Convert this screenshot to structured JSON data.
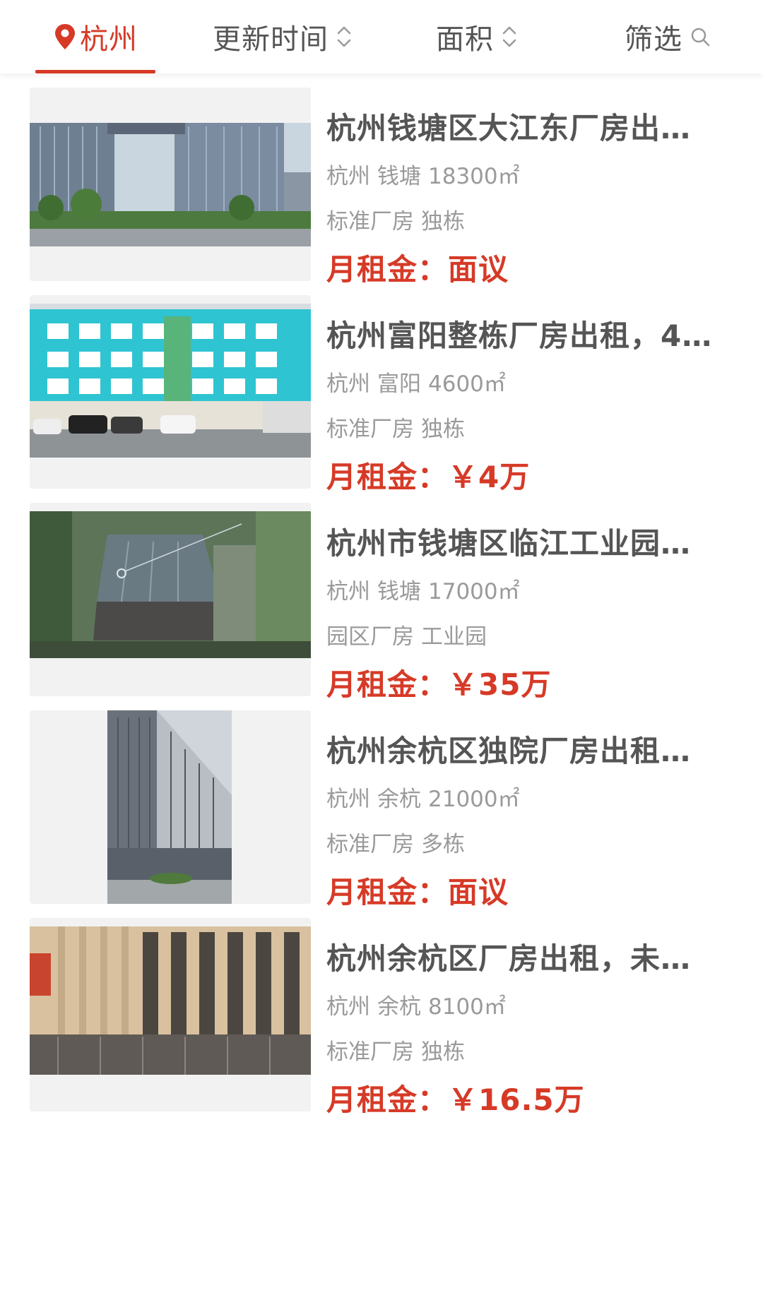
{
  "filter_bar": {
    "city": "杭州",
    "update_time": "更新时间",
    "area": "面积",
    "screen": "筛选"
  },
  "accent_color": "#d63a27",
  "listings": [
    {
      "title": "杭州钱塘区大江东厂房出…",
      "city": "杭州",
      "district": "钱塘",
      "area": "18300㎡",
      "tag1": "标准厂房",
      "tag2": "独栋",
      "rent_label": "月租金：",
      "rent_value": "面议"
    },
    {
      "title": "杭州富阳整栋厂房出租，4…",
      "city": "杭州",
      "district": "富阳",
      "area": "4600㎡",
      "tag1": "标准厂房",
      "tag2": "独栋",
      "rent_label": "月租金：",
      "rent_value": "￥4万"
    },
    {
      "title": "杭州市钱塘区临江工业园…",
      "city": "杭州",
      "district": "钱塘",
      "area": "17000㎡",
      "tag1": "园区厂房",
      "tag2": "工业园",
      "rent_label": "月租金：",
      "rent_value": "￥35万"
    },
    {
      "title": "杭州余杭区独院厂房出租…",
      "city": "杭州",
      "district": "余杭",
      "area": "21000㎡",
      "tag1": "标准厂房",
      "tag2": "多栋",
      "rent_label": "月租金：",
      "rent_value": "面议"
    },
    {
      "title": "杭州余杭区厂房出租，未…",
      "city": "杭州",
      "district": "余杭",
      "area": "8100㎡",
      "tag1": "标准厂房",
      "tag2": "独栋",
      "rent_label": "月租金：",
      "rent_value": "￥16.5万"
    }
  ]
}
